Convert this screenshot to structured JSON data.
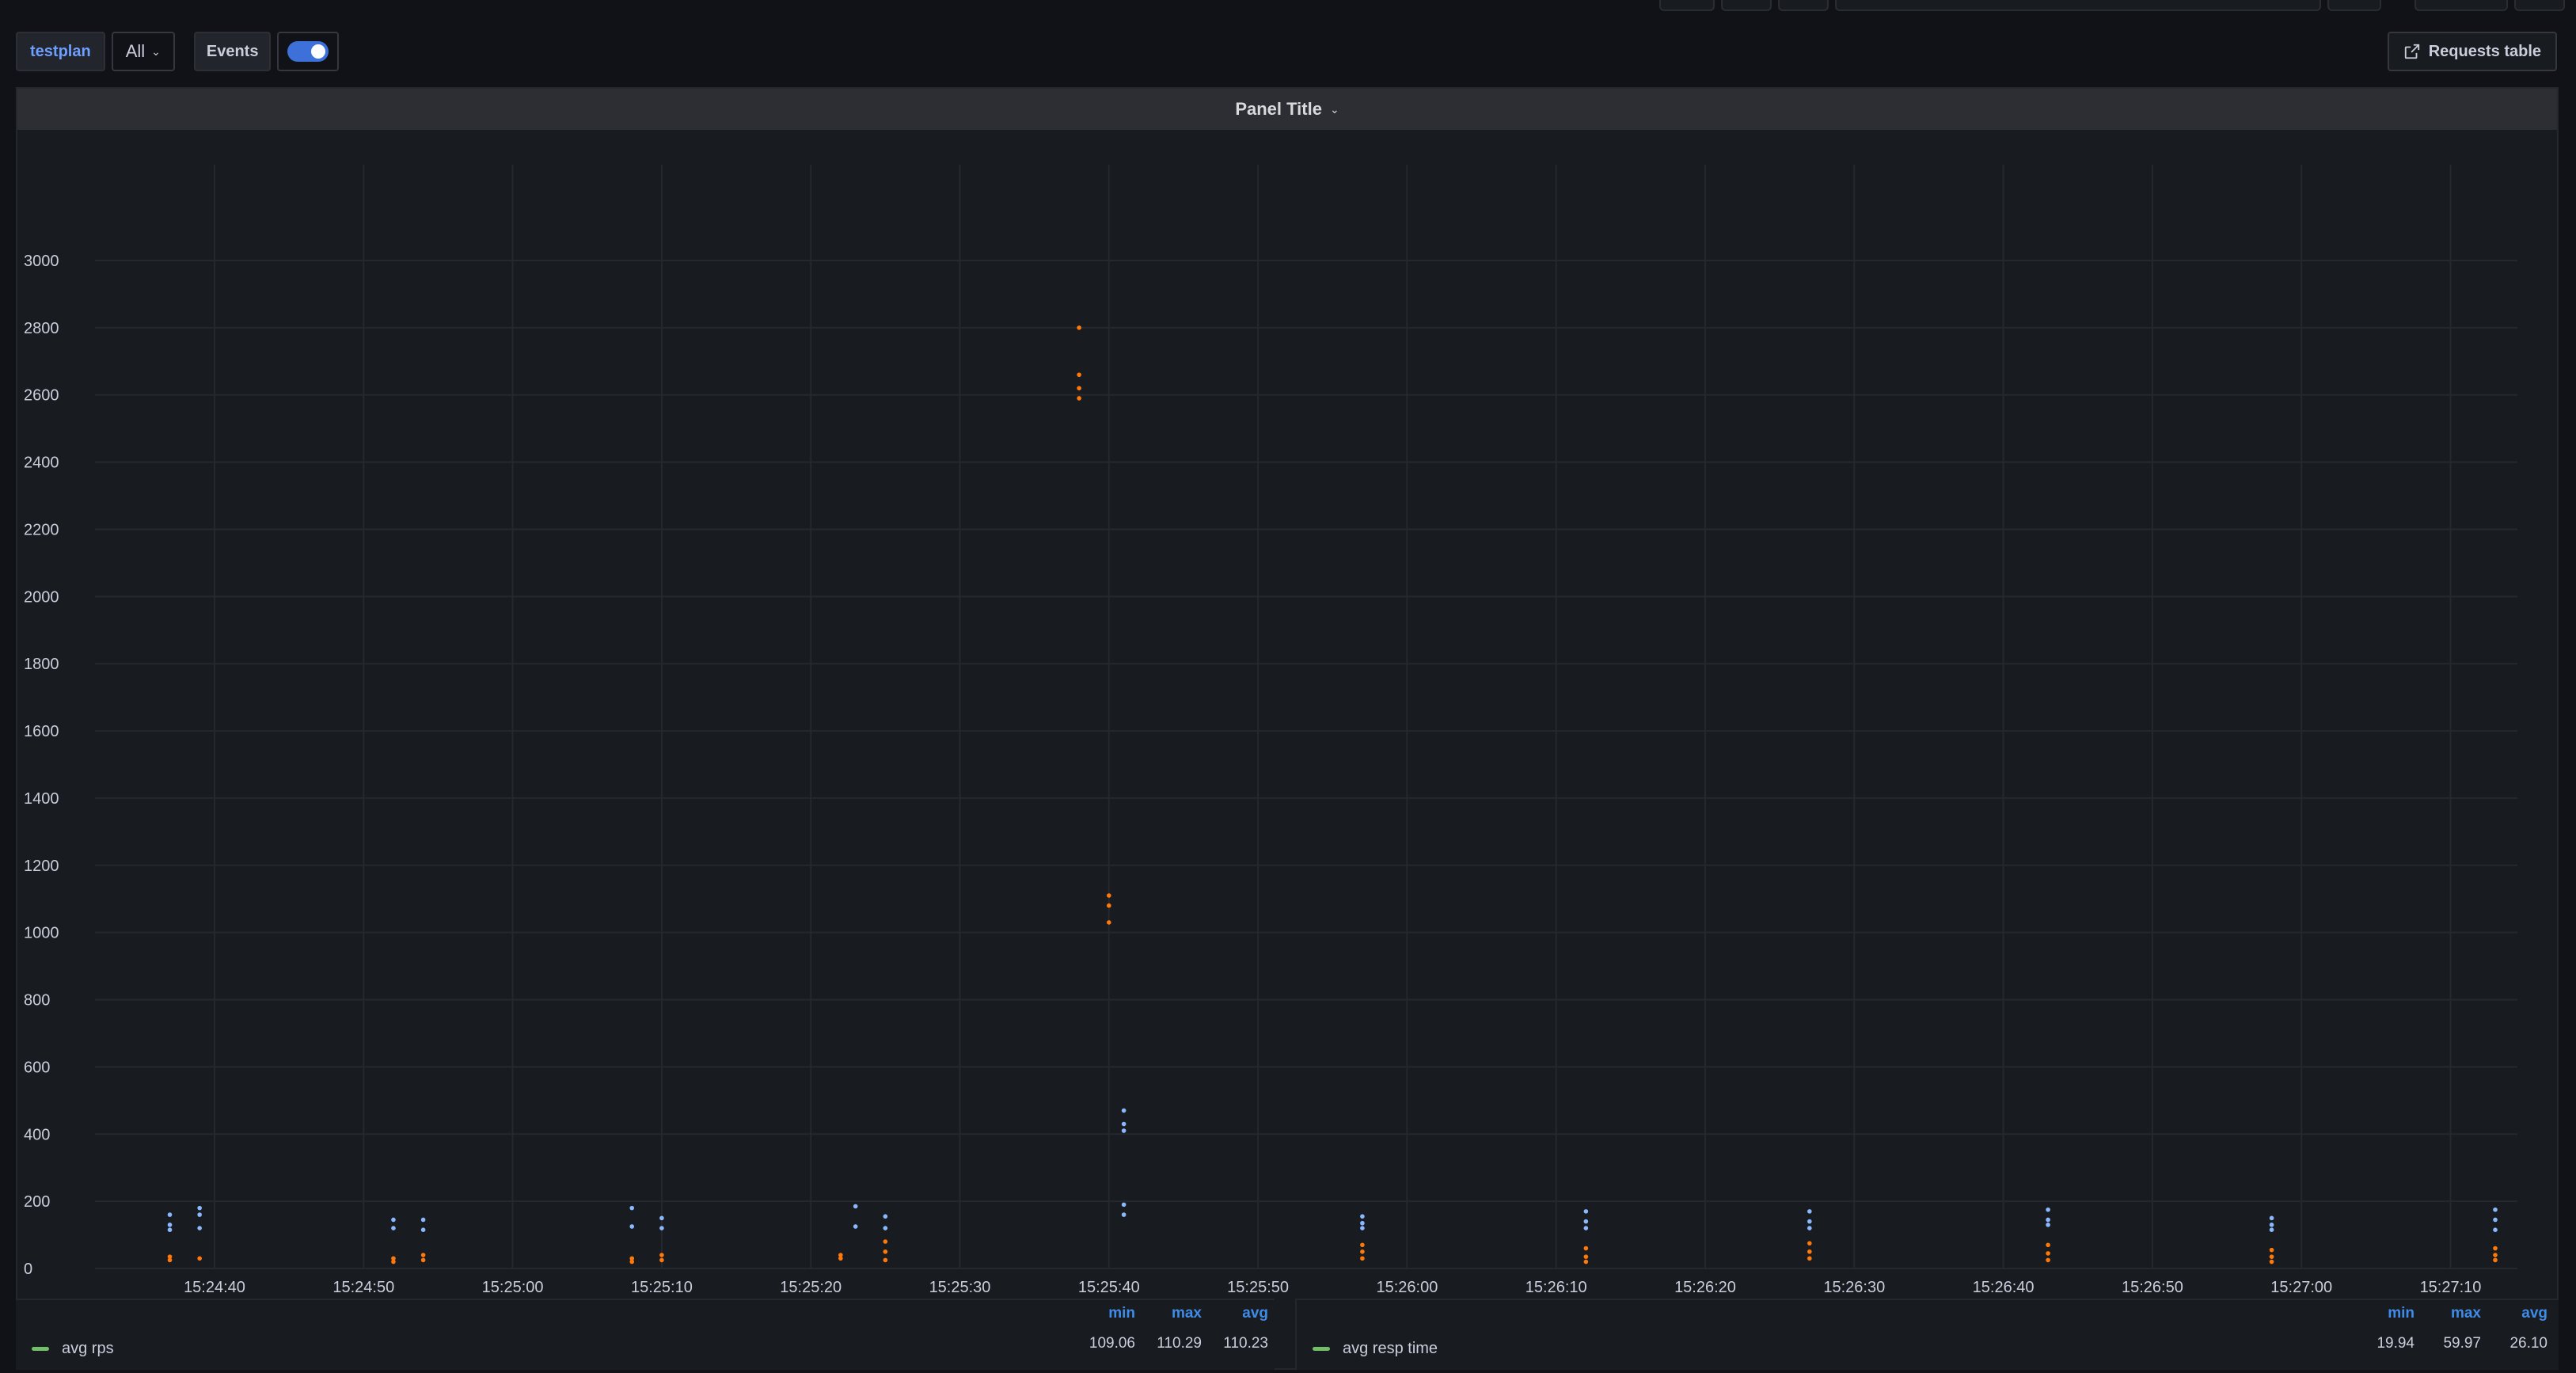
{
  "variables": {
    "testplan_label": "testplan",
    "testplan_value": "All",
    "events_label": "Events",
    "events_enabled": true
  },
  "toolbar": {
    "requests_table_label": "Requests table"
  },
  "panel": {
    "title": "Panel Title"
  },
  "colors": {
    "rps": "#73bf69",
    "resp_time": "#ff780a",
    "latency": "#8ab8ff",
    "accent": "#3d71d9"
  },
  "chart_data": {
    "type": "scatter",
    "xlabel": "",
    "ylabel": "",
    "ylim": [
      0,
      3000
    ],
    "y_ticks": [
      "0",
      "200",
      "400",
      "600",
      "800",
      "1000",
      "1200",
      "1400",
      "1600",
      "1800",
      "2000",
      "2200",
      "2400",
      "2600",
      "2800",
      "3000"
    ],
    "x_ticks": [
      "15:24:40",
      "15:24:50",
      "15:25:00",
      "15:25:10",
      "15:25:20",
      "15:25:30",
      "15:25:40",
      "15:25:50",
      "15:26:00",
      "15:26:10",
      "15:26:20",
      "15:26:30",
      "15:26:40",
      "15:26:50",
      "15:27:00",
      "15:27:10"
    ],
    "grid": true,
    "series": [
      {
        "color": "#8ab8ff",
        "points": [
          [
            "15:24:37",
            160
          ],
          [
            "15:24:37",
            130
          ],
          [
            "15:24:37",
            115
          ],
          [
            "15:24:39",
            180
          ],
          [
            "15:24:39",
            160
          ],
          [
            "15:24:39",
            120
          ],
          [
            "15:24:52",
            145
          ],
          [
            "15:24:52",
            120
          ],
          [
            "15:24:54",
            145
          ],
          [
            "15:24:54",
            115
          ],
          [
            "15:25:08",
            180
          ],
          [
            "15:25:08",
            125
          ],
          [
            "15:25:10",
            150
          ],
          [
            "15:25:10",
            120
          ],
          [
            "15:25:23",
            185
          ],
          [
            "15:25:23",
            125
          ],
          [
            "15:25:25",
            155
          ],
          [
            "15:25:25",
            120
          ],
          [
            "15:25:41",
            470
          ],
          [
            "15:25:41",
            430
          ],
          [
            "15:25:41",
            410
          ],
          [
            "15:25:41",
            190
          ],
          [
            "15:25:41",
            160
          ],
          [
            "15:25:57",
            155
          ],
          [
            "15:25:57",
            135
          ],
          [
            "15:25:57",
            120
          ],
          [
            "15:26:12",
            170
          ],
          [
            "15:26:12",
            140
          ],
          [
            "15:26:12",
            120
          ],
          [
            "15:26:27",
            170
          ],
          [
            "15:26:27",
            140
          ],
          [
            "15:26:27",
            120
          ],
          [
            "15:26:43",
            175
          ],
          [
            "15:26:43",
            145
          ],
          [
            "15:26:43",
            130
          ],
          [
            "15:26:58",
            150
          ],
          [
            "15:26:58",
            130
          ],
          [
            "15:26:58",
            115
          ],
          [
            "15:27:13",
            175
          ],
          [
            "15:27:13",
            145
          ],
          [
            "15:27:13",
            115
          ]
        ]
      },
      {
        "color": "#ff780a",
        "points": [
          [
            "15:24:37",
            35
          ],
          [
            "15:24:37",
            25
          ],
          [
            "15:24:39",
            30
          ],
          [
            "15:24:52",
            30
          ],
          [
            "15:24:52",
            20
          ],
          [
            "15:24:54",
            40
          ],
          [
            "15:24:54",
            25
          ],
          [
            "15:25:08",
            30
          ],
          [
            "15:25:08",
            20
          ],
          [
            "15:25:10",
            40
          ],
          [
            "15:25:10",
            25
          ],
          [
            "15:25:22",
            40
          ],
          [
            "15:25:22",
            30
          ],
          [
            "15:25:25",
            80
          ],
          [
            "15:25:25",
            50
          ],
          [
            "15:25:25",
            25
          ],
          [
            "15:25:38",
            2800
          ],
          [
            "15:25:38",
            2660
          ],
          [
            "15:25:38",
            2620
          ],
          [
            "15:25:38",
            2590
          ],
          [
            "15:25:40",
            1110
          ],
          [
            "15:25:40",
            1080
          ],
          [
            "15:25:40",
            1030
          ],
          [
            "15:25:57",
            70
          ],
          [
            "15:25:57",
            50
          ],
          [
            "15:25:57",
            30
          ],
          [
            "15:26:12",
            60
          ],
          [
            "15:26:12",
            35
          ],
          [
            "15:26:12",
            20
          ],
          [
            "15:26:27",
            75
          ],
          [
            "15:26:27",
            50
          ],
          [
            "15:26:27",
            30
          ],
          [
            "15:26:43",
            70
          ],
          [
            "15:26:43",
            45
          ],
          [
            "15:26:43",
            25
          ],
          [
            "15:26:58",
            55
          ],
          [
            "15:26:58",
            35
          ],
          [
            "15:26:58",
            20
          ],
          [
            "15:27:13",
            60
          ],
          [
            "15:27:13",
            40
          ],
          [
            "15:27:13",
            25
          ]
        ]
      }
    ]
  },
  "legends": {
    "left": {
      "name": "avg rps",
      "headers": [
        "min",
        "max",
        "avg"
      ],
      "values": [
        "109.06",
        "110.29",
        "110.23"
      ]
    },
    "right": {
      "name": "avg resp time",
      "headers": [
        "min",
        "max",
        "avg"
      ],
      "values": [
        "19.94",
        "59.97",
        "26.10"
      ]
    }
  }
}
